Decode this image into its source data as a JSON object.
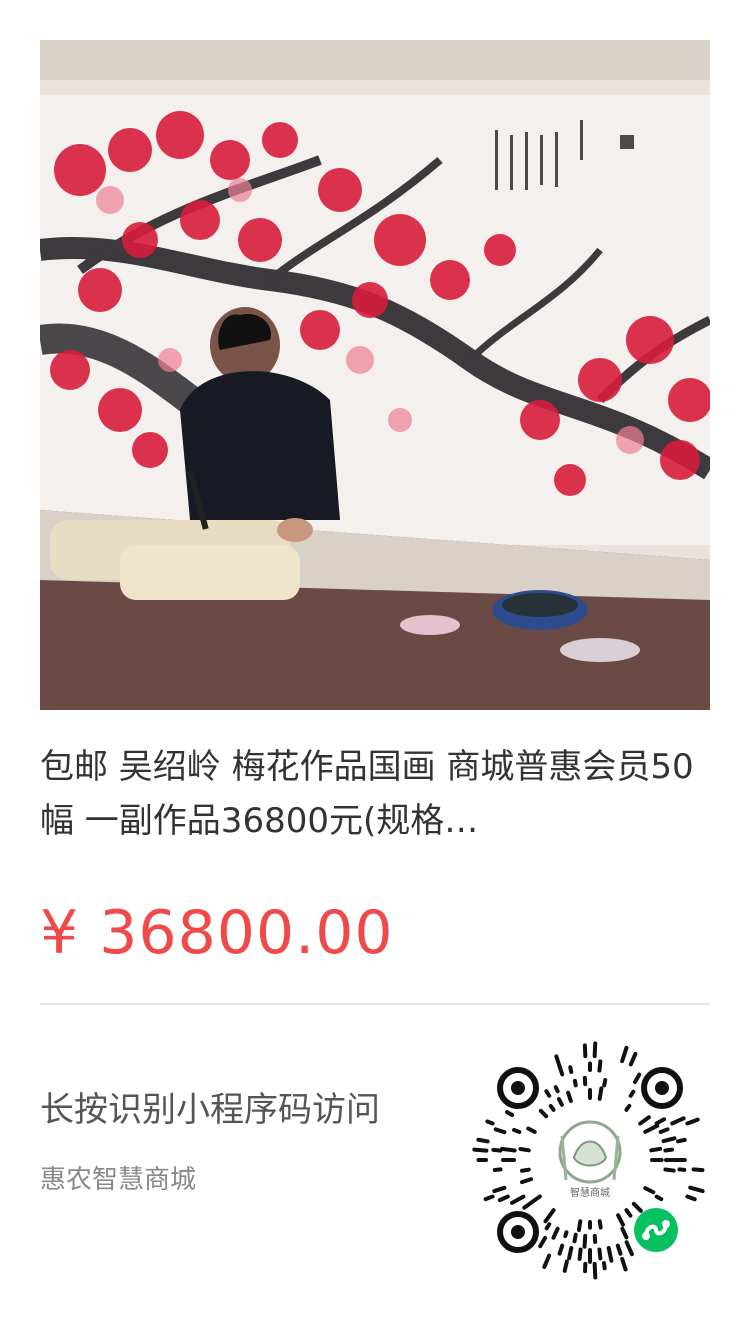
{
  "product": {
    "title": "包邮 吴绍岭 梅花作品国画 商城普惠会员50幅 一副作品36800元(规格…",
    "price": "¥ 36800.00",
    "image_icon": "painting-photo",
    "price_color": "#f0494a"
  },
  "footer": {
    "hint": "长按识别小程序码访问",
    "shop_name": "惠农智慧商城",
    "qrcode_center_text": "智慧商城",
    "qrcode_icon": "mini-program-icon",
    "accent_color": "#07c160"
  }
}
